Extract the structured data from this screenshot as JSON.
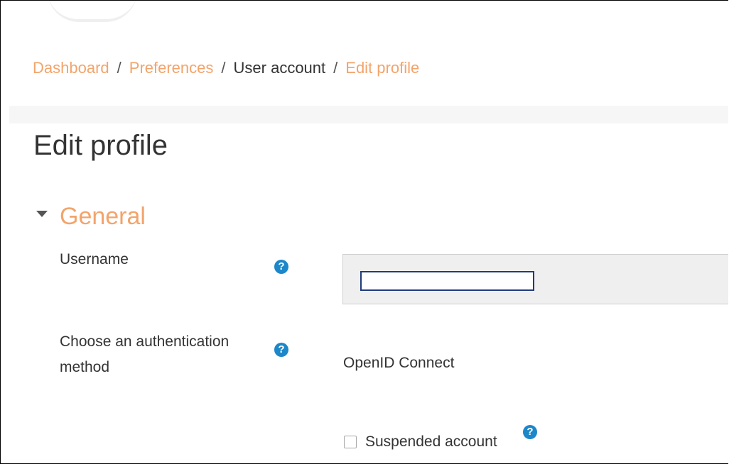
{
  "breadcrumb": {
    "items": [
      {
        "label": "Dashboard",
        "link": true
      },
      {
        "label": "Preferences",
        "link": true
      },
      {
        "label": "User account",
        "link": false
      },
      {
        "label": "Edit profile",
        "link": true
      }
    ],
    "separator": "/"
  },
  "page": {
    "title": "Edit profile"
  },
  "section": {
    "title": "General",
    "expanded": true
  },
  "form": {
    "username": {
      "label": "Username",
      "value": "",
      "help_icon": "question-circle-icon"
    },
    "auth_method": {
      "label": "Choose an authentication method",
      "value": "OpenID Connect",
      "help_icon": "question-circle-icon"
    },
    "suspended": {
      "label": "Suspended account",
      "checked": false,
      "help_icon": "question-circle-icon"
    }
  },
  "help_glyph": "?",
  "colors": {
    "accent": "#f3a46b",
    "text": "#333333",
    "help_icon": "#1c87c9",
    "focus_border": "#1f3b7a"
  }
}
